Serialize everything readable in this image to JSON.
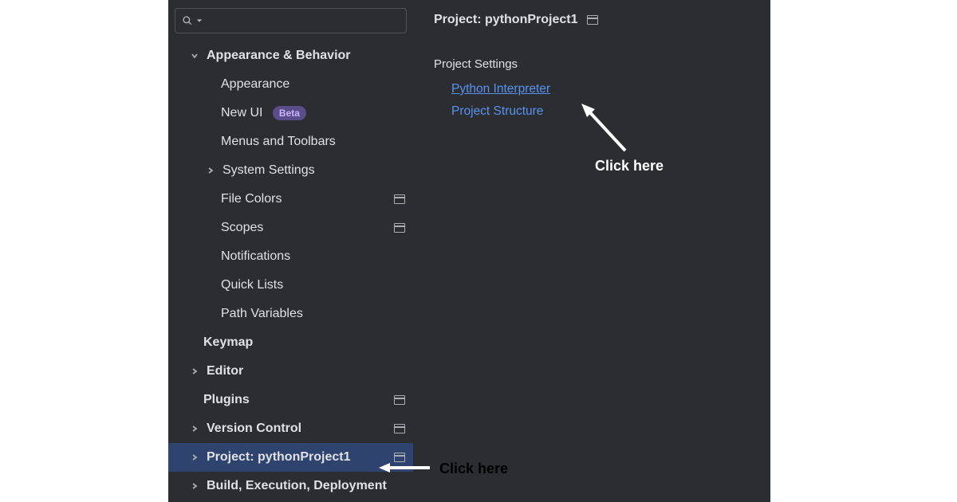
{
  "search": {
    "placeholder": ""
  },
  "sidebar": {
    "items": [
      {
        "label": "Appearance & Behavior",
        "level": "top",
        "arrow": "down"
      },
      {
        "label": "Appearance",
        "level": "sub"
      },
      {
        "label": "New UI",
        "level": "sub",
        "badge": "Beta"
      },
      {
        "label": "Menus and Toolbars",
        "level": "sub"
      },
      {
        "label": "System Settings",
        "level": "sub",
        "arrow": "right",
        "arrowAtSub": true
      },
      {
        "label": "File Colors",
        "level": "sub",
        "indicator": true
      },
      {
        "label": "Scopes",
        "level": "sub",
        "indicator": true
      },
      {
        "label": "Notifications",
        "level": "sub"
      },
      {
        "label": "Quick Lists",
        "level": "sub"
      },
      {
        "label": "Path Variables",
        "level": "sub"
      },
      {
        "label": "Keymap",
        "level": "sub2"
      },
      {
        "label": "Editor",
        "level": "sub2",
        "arrow": "right"
      },
      {
        "label": "Plugins",
        "level": "sub2",
        "indicator": true
      },
      {
        "label": "Version Control",
        "level": "sub2",
        "arrow": "right",
        "indicator": true
      },
      {
        "label": "Project: pythonProject1",
        "level": "sub2",
        "arrow": "right",
        "indicator": true,
        "selected": true
      },
      {
        "label": "Build, Execution, Deployment",
        "level": "sub2",
        "arrow": "right"
      }
    ]
  },
  "content": {
    "title": "Project: pythonProject1",
    "section": "Project Settings",
    "links": [
      {
        "label": "Python Interpreter",
        "underline": true
      },
      {
        "label": "Project Structure",
        "underline": false
      }
    ]
  },
  "annotations": {
    "a1": "Click here",
    "a2": "Click here"
  }
}
